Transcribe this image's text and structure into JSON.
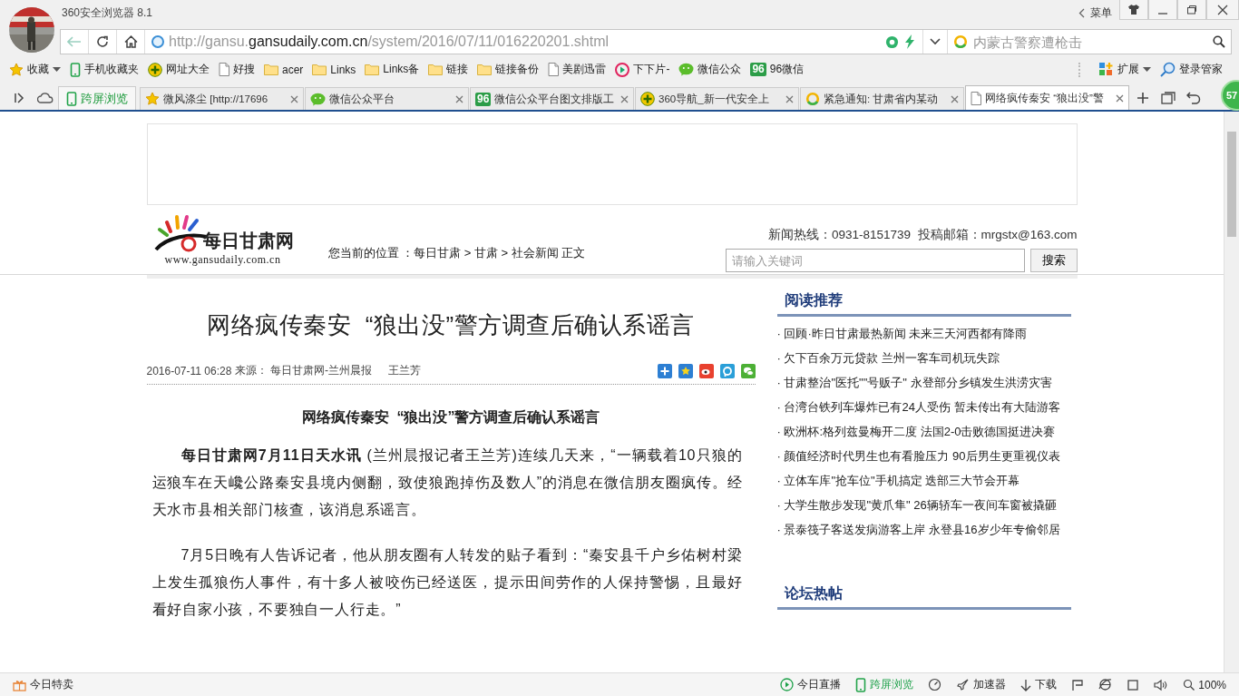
{
  "window": {
    "title": "360安全浏览器 8.1",
    "menu_label": "菜单"
  },
  "address_bar": {
    "url_prefix": "http://gansu.",
    "url_domain": "gansudaily.com.cn",
    "url_path": "/system/2016/07/11/016220201.shtml",
    "search_placeholder": "内蒙古警察遭枪击"
  },
  "bookmarks": [
    {
      "kind": "star",
      "label": "收藏",
      "dropdown": true
    },
    {
      "kind": "phone",
      "label": "手机收藏夹"
    },
    {
      "kind": "nav",
      "label": "网址大全"
    },
    {
      "kind": "page",
      "label": "好搜"
    },
    {
      "kind": "folder",
      "label": "acer"
    },
    {
      "kind": "folder",
      "label": "Links"
    },
    {
      "kind": "folder",
      "label": "Links备"
    },
    {
      "kind": "folder",
      "label": "链接"
    },
    {
      "kind": "folder",
      "label": "链接备份"
    },
    {
      "kind": "page",
      "label": "美剧迅雷"
    },
    {
      "kind": "pp",
      "label": "下下片-"
    },
    {
      "kind": "wechat",
      "label": "微信公众"
    },
    {
      "kind": "badge",
      "badge": "96",
      "label": "96微信"
    }
  ],
  "bookmarks_right": [
    {
      "kind": "extensions",
      "label": "扩展",
      "dropdown": true
    },
    {
      "kind": "login",
      "label": "登录管家"
    }
  ],
  "cross_screen_button": "跨屏浏览",
  "tabs": [
    {
      "kind": "star",
      "label": "微风涤尘 [http://17696",
      "selected": false
    },
    {
      "kind": "wechat",
      "label": "微信公众平台",
      "selected": false
    },
    {
      "kind": "badge",
      "badge": "96",
      "label": "微信公众平台图文排版工",
      "selected": false
    },
    {
      "kind": "nav",
      "label": "360导航_新一代安全上",
      "selected": false
    },
    {
      "kind": "search",
      "label": "紧急通知: 甘肃省内某动",
      "selected": false
    },
    {
      "kind": "page",
      "label": "网络疯传秦安 “狼出没”警",
      "selected": true
    }
  ],
  "notification_badge": "57",
  "site": {
    "logo_name": "每日甘肃网",
    "logo_url": "www.gansudaily.com.cn",
    "breadcrumb": "您当前的位置 ：每日甘肃 > 甘肃 > 社会新闻 正文",
    "contact": "新闻热线：0931-8151739  投稿邮箱：mrgstx@163.com",
    "search_placeholder": "请输入关键词",
    "search_button": "搜索"
  },
  "article": {
    "headline": "网络疯传秦安  “狼出没”警方调查后确认系谣言",
    "date": "2016-07-11 06:28",
    "source": "来源： 每日甘肃网-兰州晨报",
    "author": "王兰芳",
    "share_buttons": [
      {
        "kind": "more"
      },
      {
        "kind": "qzone"
      },
      {
        "kind": "weibo"
      },
      {
        "kind": "tencent"
      },
      {
        "kind": "wechat"
      }
    ],
    "subtitle": "网络疯传秦安  “狼出没”警方调查后确认系谣言",
    "paragraphs": [
      "**每日甘肃网7月11日天水讯** (兰州晨报记者王兰芳)连续几天来，“一辆载着10只狼的运狼车在天巉公路秦安县境内侧翻，致使狼跑掉伤及数人”的消息在微信朋友圈疯传。经天水市县相关部门核查，该消息系谣言。",
      "7月5日晚有人告诉记者，他从朋友圈有人转发的贴子看到：“秦安县千户乡佑树村梁上发生孤狼伤人事件，有十多人被咬伤已经送医，提示田间劳作的人保持警惕，且最好看好自家小孩，不要独自一人行走。”"
    ]
  },
  "sidebar": {
    "recommended_title": "阅读推荐",
    "recommended": [
      "· 回顾·昨日甘肃最热新闻 未来三天河西都有降雨",
      "· 欠下百余万元贷款 兰州一客车司机玩失踪",
      "· 甘肃整治\"医托\"\"号贩子\" 永登部分乡镇发生洪涝灾害",
      "· 台湾台铁列车爆炸已有24人受伤 暂未传出有大陆游客",
      "· 欧洲杯:格列兹曼梅开二度 法国2-0击败德国挺进决赛",
      "· 颜值经济时代男生也有看脸压力 90后男生更重视仪表",
      "· 立体车库\"抢车位\"手机搞定 迭部三大节会开幕",
      "· 大学生散步发现\"黄爪隼\" 26辆轿车一夜间车窗被撬砸",
      "· 景泰筏子客送发病游客上岸 永登县16岁少年专偷邻居"
    ],
    "forum_title": "论坛热帖"
  },
  "status_bar": {
    "left": [
      {
        "kind": "gift",
        "label": "今日特卖"
      }
    ],
    "right": [
      {
        "kind": "live",
        "label": "今日直播"
      },
      {
        "kind": "cross",
        "label": "跨屏浏览"
      },
      {
        "kind": "speed"
      },
      {
        "kind": "accel",
        "label": "加速器"
      },
      {
        "kind": "download",
        "label": "下载"
      },
      {
        "kind": "flag"
      },
      {
        "kind": "ie"
      },
      {
        "kind": "window"
      },
      {
        "kind": "sound"
      },
      {
        "kind": "zoom",
        "label": "100%"
      }
    ]
  }
}
